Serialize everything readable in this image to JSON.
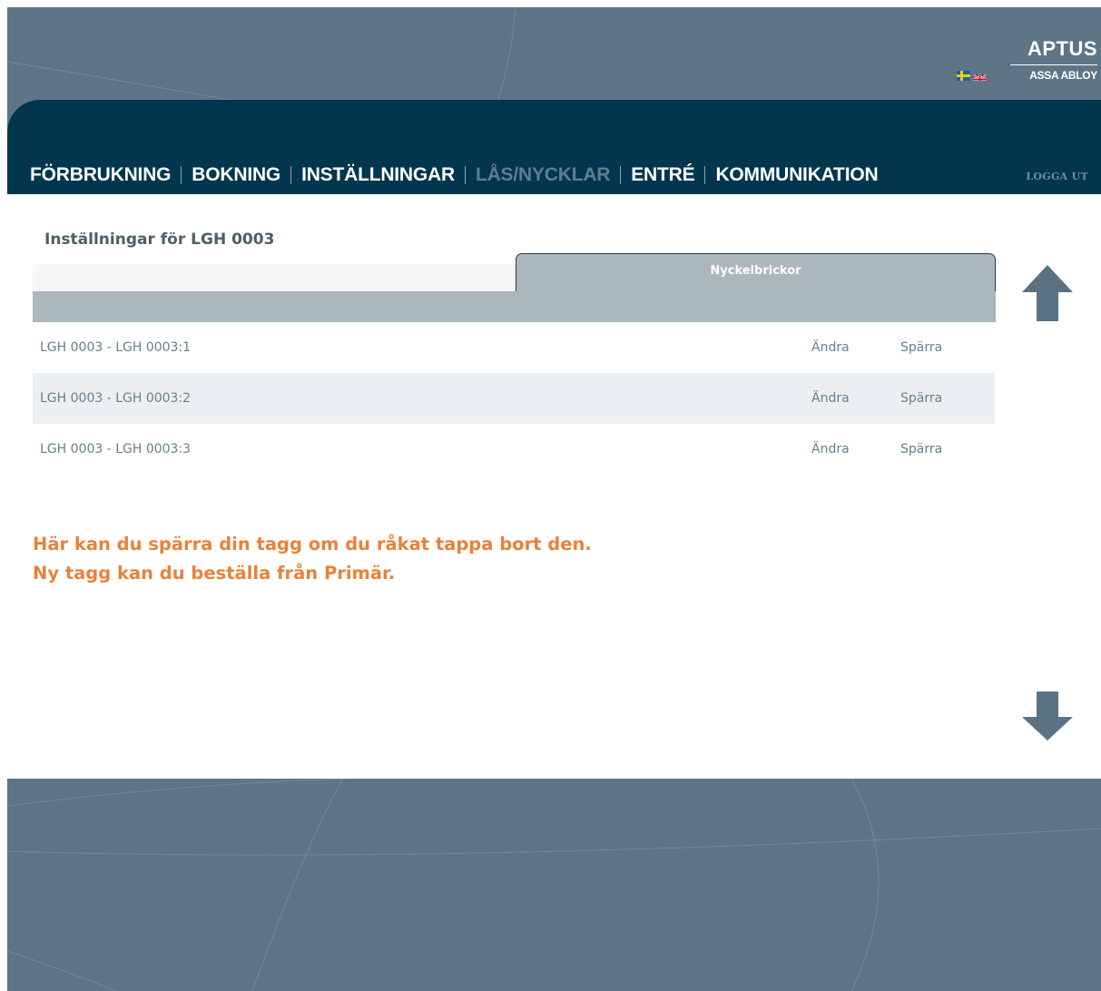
{
  "brand": {
    "name": "APTUS",
    "parent": "ASSA ABLOY"
  },
  "languages": [
    {
      "name": "Svenska",
      "icon": "sweden-flag-icon"
    },
    {
      "name": "English",
      "icon": "uk-flag-icon"
    }
  ],
  "nav": {
    "items": [
      "FÖRBRUKNING",
      "BOKNING",
      "INSTÄLLNINGAR",
      "LÅS/NYCKLAR",
      "ENTRÉ",
      "KOMMUNIKATION"
    ],
    "active_index": 3,
    "logout": "LOGGA UT"
  },
  "page": {
    "title": "Inställningar för LGH 0003"
  },
  "tab": {
    "label": "Nyckelbrickor"
  },
  "keys": [
    {
      "label": "LGH 0003 - LGH 0003:1",
      "edit": "Ändra",
      "block": "Spärra"
    },
    {
      "label": "LGH 0003 - LGH 0003:2",
      "edit": "Ändra",
      "block": "Spärra"
    },
    {
      "label": "LGH 0003 - LGH 0003:3",
      "edit": "Ändra",
      "block": "Spärra"
    }
  ],
  "note": {
    "line1": "Här kan du spärra din tagg om du råkat tappa bort den.",
    "line2": "Ny tagg kan du beställa från Primär."
  },
  "colors": {
    "background": "#5e7585",
    "header": "#02364f",
    "tab": "#aab7bd",
    "note": "#e8823a",
    "arrows": "#5a7384"
  },
  "scroll": {
    "up_icon": "arrow-up-icon",
    "down_icon": "arrow-down-icon"
  }
}
